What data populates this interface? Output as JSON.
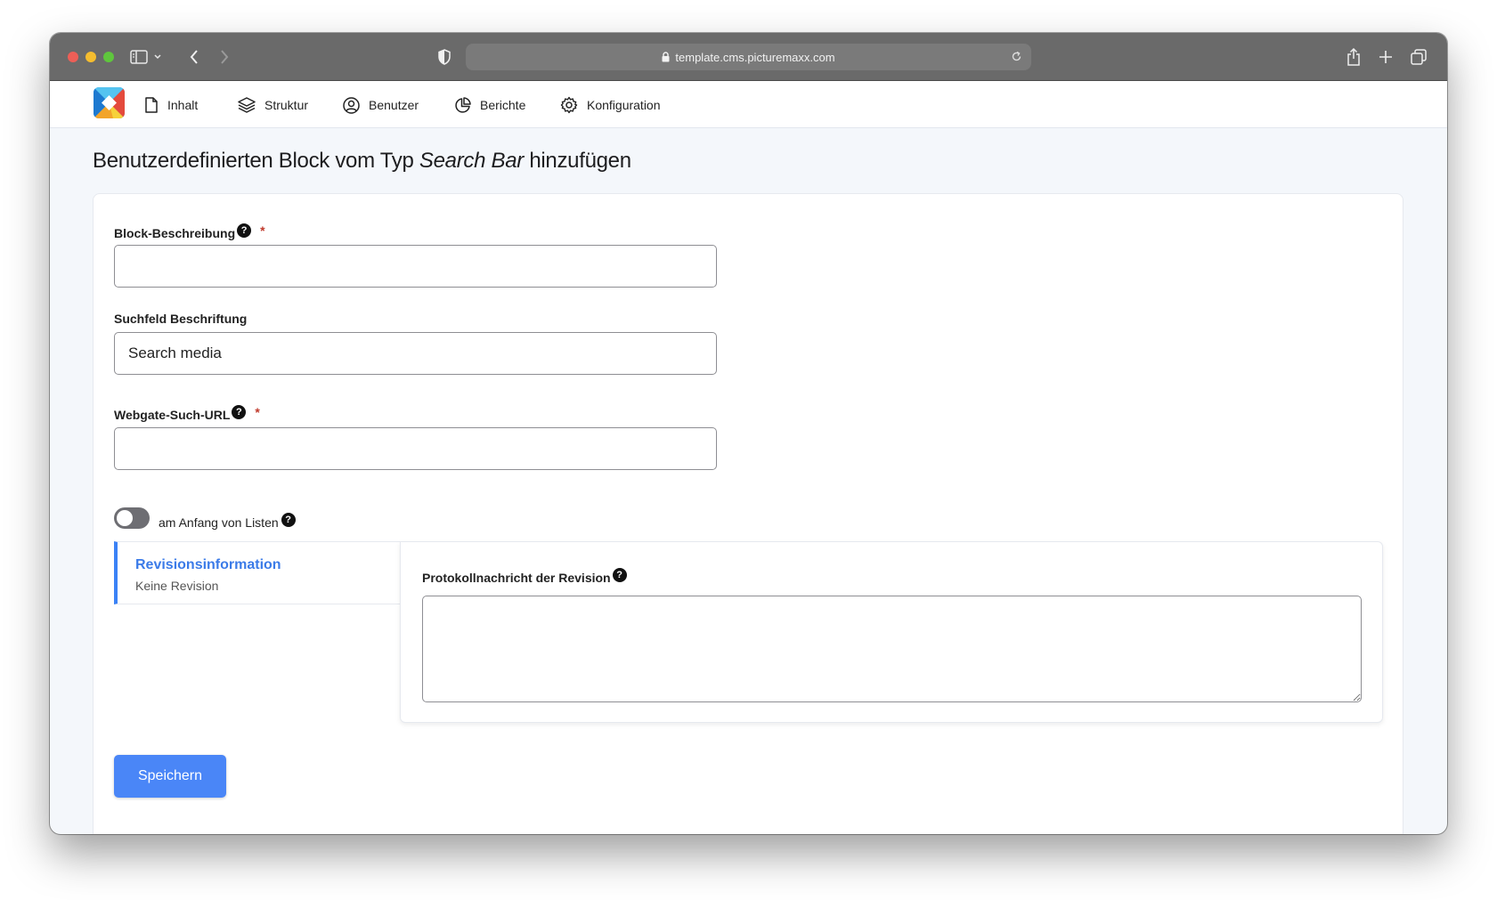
{
  "browser": {
    "url": "template.cms.picturemaxx.com"
  },
  "nav": {
    "items": [
      {
        "label": "Inhalt",
        "icon": "file-icon"
      },
      {
        "label": "Struktur",
        "icon": "layers-icon"
      },
      {
        "label": "Benutzer",
        "icon": "user-circle-icon"
      },
      {
        "label": "Berichte",
        "icon": "pie-chart-icon"
      },
      {
        "label": "Konfiguration",
        "icon": "gear-icon"
      }
    ]
  },
  "page": {
    "title_prefix": "Benutzerdefinierten Block vom Typ ",
    "title_type": "Search Bar",
    "title_suffix": " hinzufügen"
  },
  "form": {
    "block_description": {
      "label": "Block-Beschreibung",
      "required_mark": "*",
      "value": ""
    },
    "search_label": {
      "label": "Suchfeld Beschriftung",
      "value": "Search media"
    },
    "webgate_url": {
      "label": "Webgate-Such-URL",
      "required_mark": "*",
      "value": ""
    },
    "toggle": {
      "label": "am Anfang von Listen",
      "checked": false
    },
    "help_glyph": "?",
    "revision": {
      "tab_title": "Revisionsinformation",
      "tab_subtitle": "Keine Revision",
      "log_label": "Protokollnachricht der Revision",
      "log_value": ""
    },
    "save_label": "Speichern"
  },
  "colors": {
    "accent": "#4a86f7",
    "tab_border": "#3b82f6",
    "required": "#c0392b"
  }
}
